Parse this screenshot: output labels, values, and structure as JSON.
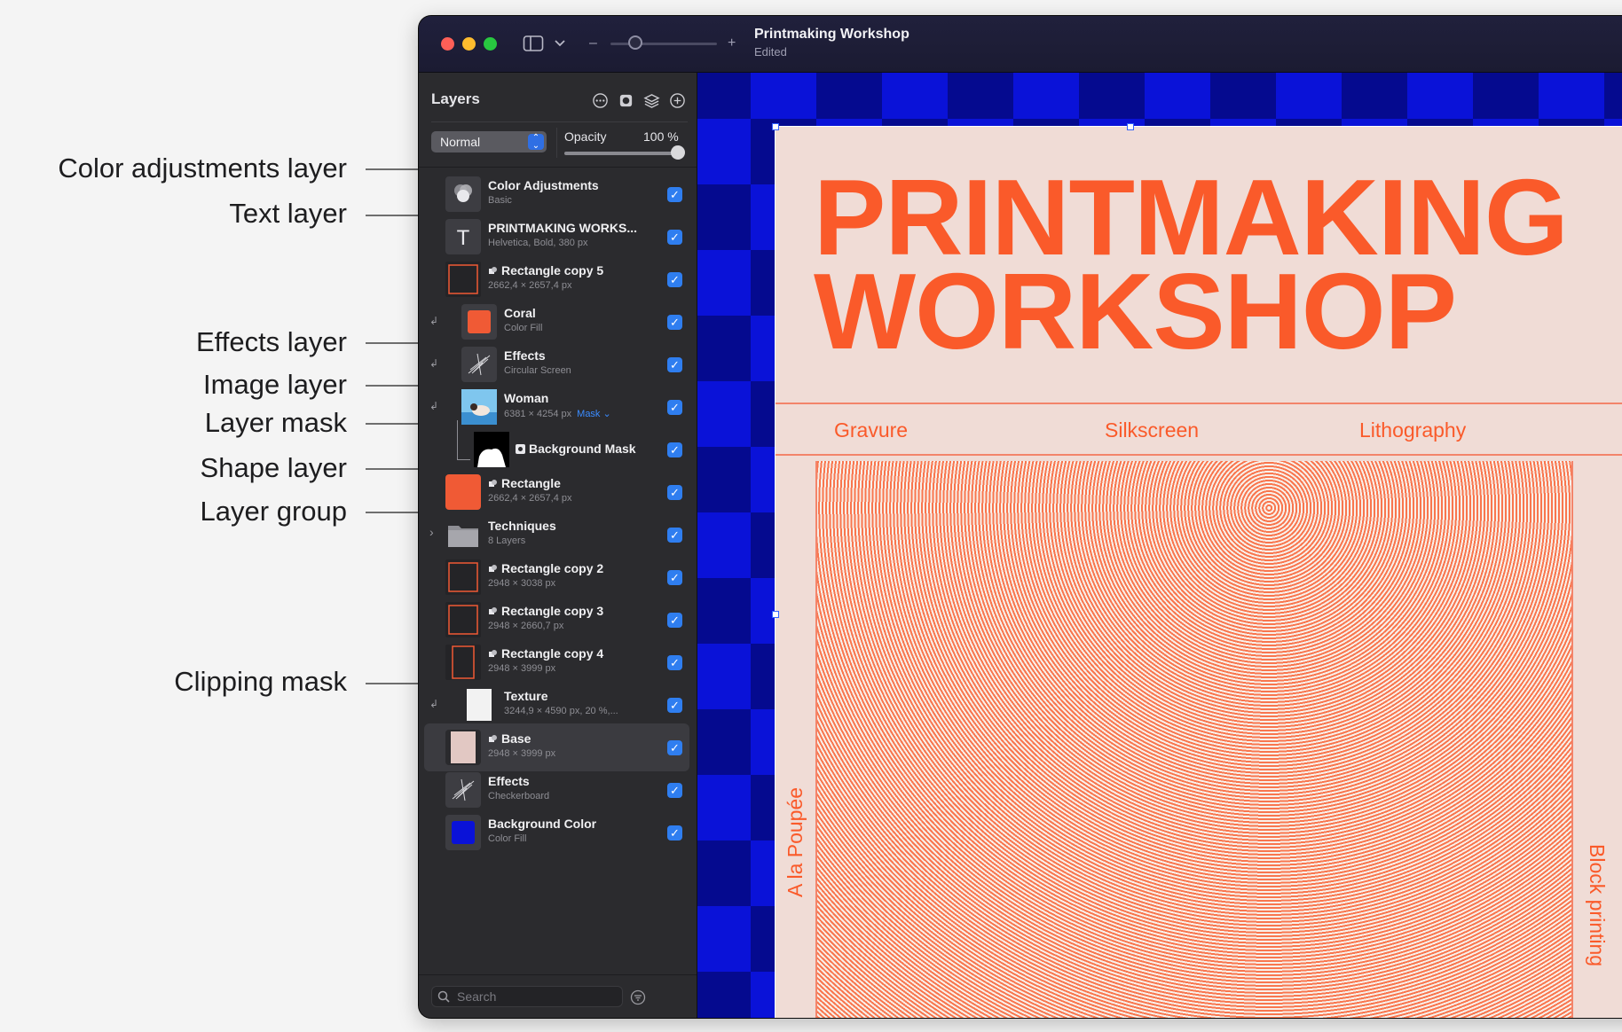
{
  "annotations": [
    {
      "label": "Color adjustments layer"
    },
    {
      "label": "Text layer"
    },
    {
      "label": "Effects layer"
    },
    {
      "label": "Image layer"
    },
    {
      "label": "Layer mask"
    },
    {
      "label": "Shape layer"
    },
    {
      "label": "Layer group"
    },
    {
      "label": "Clipping mask"
    }
  ],
  "window": {
    "title": "Printmaking Workshop",
    "subtitle": "Edited",
    "zoom_minus": "–",
    "zoom_plus": "+"
  },
  "panel": {
    "title": "Layers",
    "blend_mode": "Normal",
    "opacity_label": "Opacity",
    "opacity_value": "100 %",
    "opacity_level": 1.0,
    "search_placeholder": "Search",
    "icons": [
      "more-icon",
      "mask-icon",
      "layers-stack-icon",
      "add-icon"
    ]
  },
  "layers": [
    {
      "name": "Color Adjustments",
      "meta": "Basic",
      "kind": "adjustments",
      "checked": true
    },
    {
      "name": "PRINTMAKING WORKS...",
      "meta": "Helvetica, Bold, 380 px",
      "kind": "text",
      "checked": true
    },
    {
      "name": "Rectangle copy 5",
      "meta": "2662,4 × 2657,4 px",
      "kind": "rect-outline",
      "checked": true
    },
    {
      "name": "Coral",
      "meta": "Color Fill",
      "kind": "color-fill",
      "color": "#f05a35",
      "checked": true
    },
    {
      "name": "Effects",
      "meta": "Circular Screen",
      "kind": "effects",
      "checked": true
    },
    {
      "name": "Woman",
      "meta": "6381 × 4254 px",
      "mask_label": "Mask",
      "kind": "image",
      "checked": true
    },
    {
      "name": "Background Mask",
      "meta": "",
      "kind": "mask",
      "checked": true
    },
    {
      "name": "Rectangle",
      "meta": "2662,4 × 2657,4 px",
      "kind": "rect-fill",
      "color": "#f05a35",
      "checked": true
    },
    {
      "name": "Techniques",
      "meta": "8 Layers",
      "kind": "group",
      "checked": true
    },
    {
      "name": "Rectangle copy 2",
      "meta": "2948 × 3038 px",
      "kind": "rect-outline",
      "checked": true
    },
    {
      "name": "Rectangle copy 3",
      "meta": "2948 × 2660,7 px",
      "kind": "rect-outline",
      "checked": true
    },
    {
      "name": "Rectangle copy 4",
      "meta": "2948 × 3999 px",
      "kind": "rect-outline-tall",
      "checked": true
    },
    {
      "name": "Texture",
      "meta": "3244,9 × 4590 px, 20 %,...",
      "kind": "texture",
      "checked": true
    },
    {
      "name": "Base",
      "meta": "2948 × 3999 px",
      "kind": "base",
      "color": "#e2c8c3",
      "checked": true,
      "selected": true
    },
    {
      "name": "Effects",
      "meta": "Checkerboard",
      "kind": "effects",
      "checked": true
    },
    {
      "name": "Background Color",
      "meta": "Color Fill",
      "kind": "color-fill",
      "color": "#0a12d8",
      "checked": true
    }
  ],
  "poster": {
    "title": "PRINTMAKING\nWORKSHOP",
    "techniques": [
      "Gravure",
      "Silkscreen",
      "Lithography"
    ],
    "side_left": "A la Poupée",
    "side_right": "Block printing",
    "accent": "#fa5a2a",
    "paper": "#f0dcd6",
    "background": "#0a12d8"
  }
}
